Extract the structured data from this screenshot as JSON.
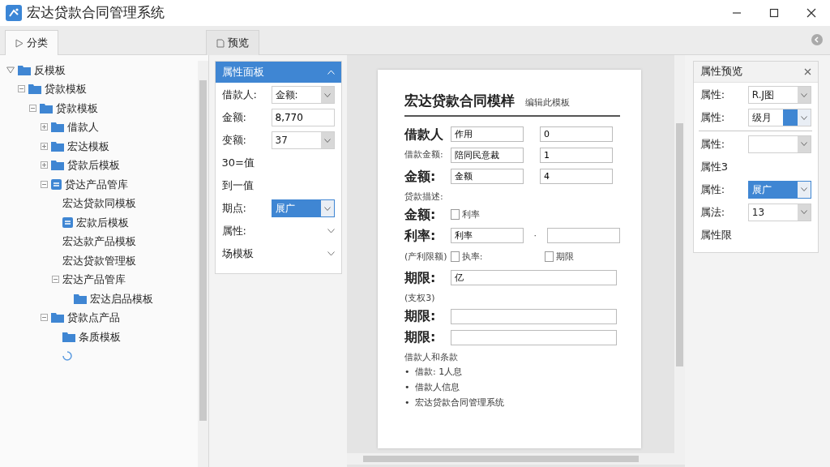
{
  "window": {
    "title": "宏达贷款合同管理系统"
  },
  "tabs": [
    {
      "label": "分类",
      "selected": true
    },
    {
      "label": "预览",
      "selected": false
    }
  ],
  "tree": [
    {
      "label": "反模板",
      "kind": "folder",
      "expanded": true,
      "children": [
        {
          "label": "贷款模板",
          "kind": "folder",
          "expanded": true,
          "children": [
            {
              "label": "贷款模板",
              "kind": "folder",
              "expanded": true,
              "children": [
                {
                  "label": "借款人",
                  "kind": "folder",
                  "expanded": false
                },
                {
                  "label": "宏达模板",
                  "kind": "folder",
                  "expanded": false
                },
                {
                  "label": "贷款后模板",
                  "kind": "folder",
                  "expanded": false
                },
                {
                  "label": "贷达产品管库",
                  "kind": "app",
                  "expanded": true,
                  "children": [
                    {
                      "label": "宏达贷款同模板",
                      "kind": "none"
                    },
                    {
                      "label": "宏款后模板",
                      "kind": "app"
                    },
                    {
                      "label": "宏达款产品模板",
                      "kind": "none"
                    },
                    {
                      "label": "宏达贷款管理板",
                      "kind": "none"
                    },
                    {
                      "label": "宏达产品管库",
                      "kind": "none",
                      "expanded": true,
                      "children": [
                        {
                          "label": "宏达启品模板",
                          "kind": "folder"
                        }
                      ]
                    }
                  ]
                },
                {
                  "label": "贷款点产品",
                  "kind": "folder",
                  "expanded": true,
                  "children": [
                    {
                      "label": "条质模板",
                      "kind": "folder"
                    },
                    {
                      "kind": "spinner"
                    }
                  ]
                }
              ]
            }
          ]
        }
      ]
    }
  ],
  "properties": {
    "title": "属性面板",
    "expanded": true,
    "rows": [
      {
        "kind": "select",
        "label": "借款人:",
        "value": "金额:",
        "highlighted": false
      },
      {
        "kind": "input",
        "label": "金额:",
        "value": "8,770"
      },
      {
        "kind": "select",
        "label": "变额:",
        "value": "37",
        "highlighted": false
      },
      {
        "kind": "note",
        "label": "30=值"
      },
      {
        "kind": "note",
        "label": "到一值"
      },
      {
        "kind": "select",
        "label": "期点:",
        "value": "展广",
        "highlighted": true
      },
      {
        "kind": "collapsed",
        "label": "属性:"
      },
      {
        "kind": "collapsed",
        "label": "场模板"
      }
    ]
  },
  "document": {
    "title": "宏达贷款合同模样",
    "subtitle": "编辑此模板",
    "rows": [
      {
        "kind": "field-row",
        "label": "借款人",
        "emphasis": true,
        "fields": [
          {
            "value": "作用"
          },
          {
            "value": "0"
          }
        ]
      },
      {
        "kind": "field-row",
        "label": "借款金额:",
        "emphasis": false,
        "fields": [
          {
            "value": "陪同民意裁"
          },
          {
            "value": "1"
          }
        ]
      },
      {
        "kind": "field-row",
        "label": "金额:",
        "emphasis": true,
        "fields": [
          {
            "value": "金额"
          },
          {
            "value": "4"
          }
        ]
      },
      {
        "kind": "note",
        "label": "贷款描述:"
      },
      {
        "kind": "check-row",
        "label": "金额:",
        "emphasis": true,
        "checks": [
          {
            "label": "利率",
            "checked": false
          }
        ]
      },
      {
        "kind": "field-row",
        "label": "利率:",
        "emphasis": true,
        "separator": "·",
        "fields": [
          {
            "kind": "filled",
            "value": "利率"
          },
          {
            "kind": "blank"
          }
        ]
      },
      {
        "kind": "check-row",
        "label": "(产利限额)",
        "emphasis": false,
        "checks": [
          {
            "label": "执率:",
            "checked": false
          },
          {
            "label": "期限",
            "checked": false
          }
        ]
      },
      {
        "kind": "field-row",
        "label": "期限:",
        "emphasis": true,
        "fields": [
          {
            "value": "亿"
          }
        ]
      },
      {
        "kind": "note",
        "label": "(支权3)"
      },
      {
        "kind": "field-row",
        "label": "期限:",
        "emphasis": true,
        "fields": [
          {
            "kind": "blank"
          }
        ]
      },
      {
        "kind": "field-row",
        "label": "期限:",
        "emphasis": true,
        "fields": [
          {
            "kind": "blank"
          }
        ]
      },
      {
        "kind": "note",
        "label": "借款人和条款"
      },
      {
        "kind": "bullets",
        "items": [
          {
            "marker": "•",
            "text": "借款: 1人息"
          },
          {
            "marker": "•",
            "text": "借款人信息"
          },
          {
            "marker": "•",
            "text": "宏达贷款合同管理系统"
          }
        ]
      }
    ]
  },
  "preview": {
    "title": "属性预览",
    "rows": [
      {
        "kind": "select",
        "label": "属性:",
        "value": "R.J图",
        "highlighted": false
      },
      {
        "kind": "split-select",
        "label": "属性:",
        "value": "级月"
      },
      {
        "kind": "divider"
      },
      {
        "kind": "select",
        "label": "属性:",
        "highlighted": false
      },
      {
        "kind": "note",
        "label": "属性3"
      },
      {
        "kind": "select",
        "label": "属性:",
        "value": "展广",
        "highlighted": true
      },
      {
        "kind": "select",
        "label": "属法:",
        "value": "13",
        "highlighted": false
      },
      {
        "kind": "note",
        "label": "属性限"
      }
    ]
  }
}
